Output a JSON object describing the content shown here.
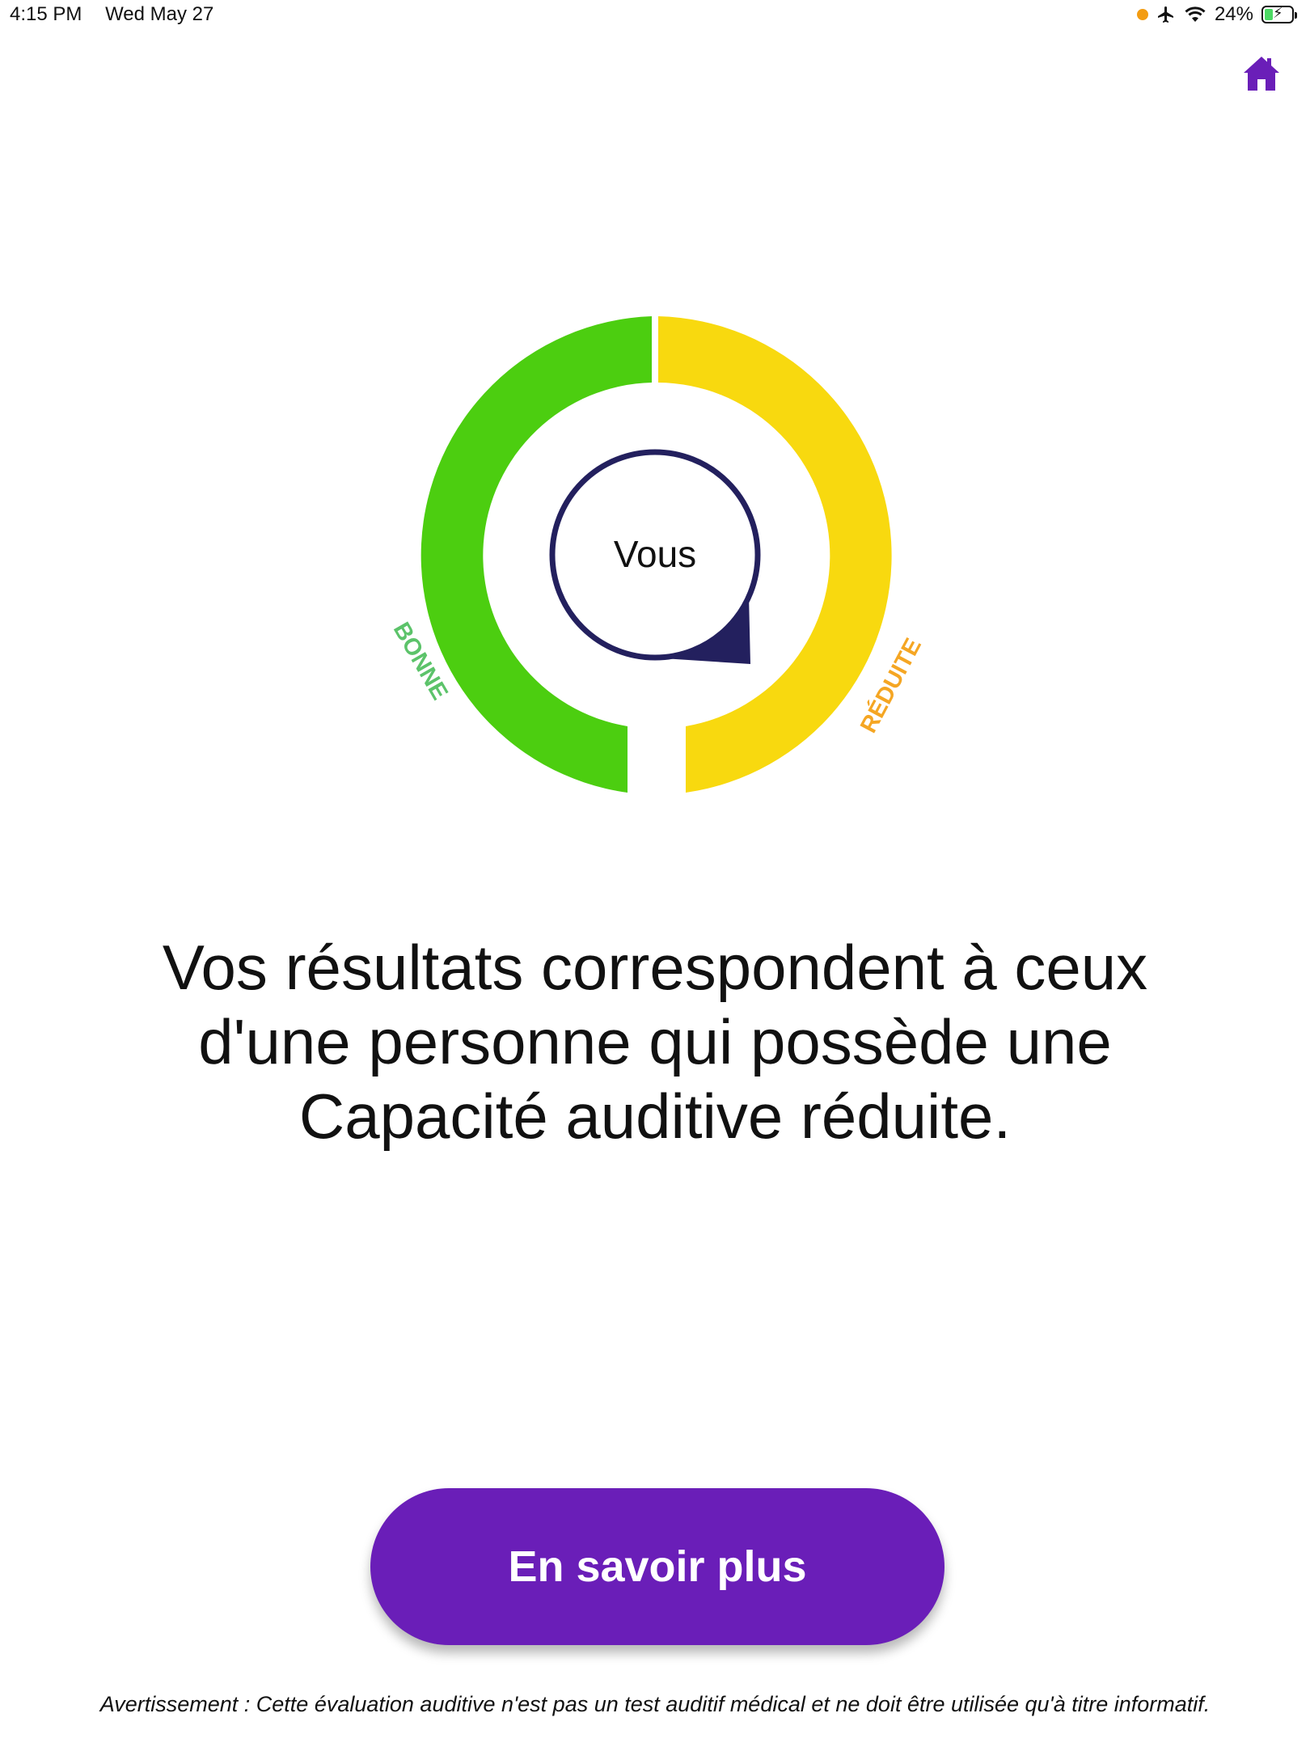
{
  "status_bar": {
    "time": "4:15 PM",
    "date": "Wed May 27",
    "battery": "24%",
    "icons": [
      "orange-dot",
      "airplane-icon",
      "wifi-icon",
      "battery-icon"
    ]
  },
  "header": {
    "home_icon": "home-icon"
  },
  "gauge": {
    "center_label": "Vous",
    "left_label": "BONNE",
    "right_label": "RÉDUITE",
    "colors": {
      "good": "#4cce10",
      "reduced": "#f8d90f",
      "good_label": "#5cc36a",
      "reduced_label": "#f5a623",
      "pointer": "#23205e"
    }
  },
  "result": {
    "line1": "Vos résultats correspondent à ceux",
    "line2": "d'une personne qui possède une",
    "highlight": "Capacité auditive réduite",
    "end": "."
  },
  "cta": {
    "label": "En savoir plus",
    "color": "#6a1eb8"
  },
  "disclaimer": "Avertissement : Cette évaluation auditive n'est pas un test auditif médical et ne doit être utilisée qu'à titre informatif."
}
